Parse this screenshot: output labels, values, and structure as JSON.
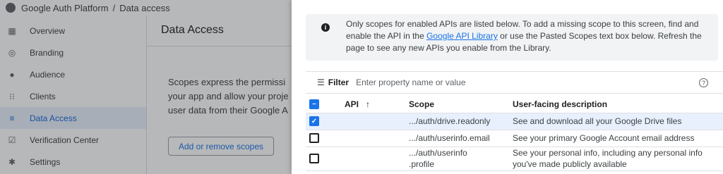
{
  "topbar": {
    "product": "Google Auth Platform",
    "separator": "/",
    "page": "Data access"
  },
  "sidebar": {
    "items": [
      {
        "label": "Overview",
        "icon": "grid-icon"
      },
      {
        "label": "Branding",
        "icon": "palette-icon"
      },
      {
        "label": "Audience",
        "icon": "person-icon"
      },
      {
        "label": "Clients",
        "icon": "dots-grid-icon"
      },
      {
        "label": "Data Access",
        "icon": "data-access-icon",
        "active": true
      },
      {
        "label": "Verification Center",
        "icon": "verified-icon"
      },
      {
        "label": "Settings",
        "icon": "gear-icon"
      }
    ]
  },
  "main": {
    "heading": "Data Access",
    "description": [
      "Scopes express the permissi",
      "your app and allow your proje",
      "user data from their Google A"
    ],
    "scopes_button": "Add or remove scopes"
  },
  "drawer": {
    "info": {
      "text_before": "Only scopes for enabled APIs are listed below. To add a missing scope to this screen, find and enable the API in the ",
      "link": "Google API Library",
      "text_after": " or use the Pasted Scopes text box below. Refresh the page to see any new APIs you enable from the Library."
    },
    "filter": {
      "label": "Filter",
      "placeholder": "Enter property name or value"
    },
    "table": {
      "headers": {
        "api": "API",
        "scope": "Scope",
        "description": "User-facing description"
      },
      "rows": [
        {
          "scope": ".../auth/drive.readonly",
          "description": "See and download all your Google Drive files",
          "checked": true
        },
        {
          "scope": ".../auth/userinfo.email",
          "description": "See your primary Google Account email address",
          "checked": false
        },
        {
          "scope_line1": ".../auth/userinfo",
          "scope_line2": ".profile",
          "description_line1": "See your personal info, including any personal info",
          "description_line2": "you've made publicly available",
          "checked": false
        }
      ]
    }
  },
  "colors": {
    "accent": "#1a73e8",
    "selected_row": "#e8f0fe",
    "scrim": "rgba(32,33,36,0.32)"
  }
}
